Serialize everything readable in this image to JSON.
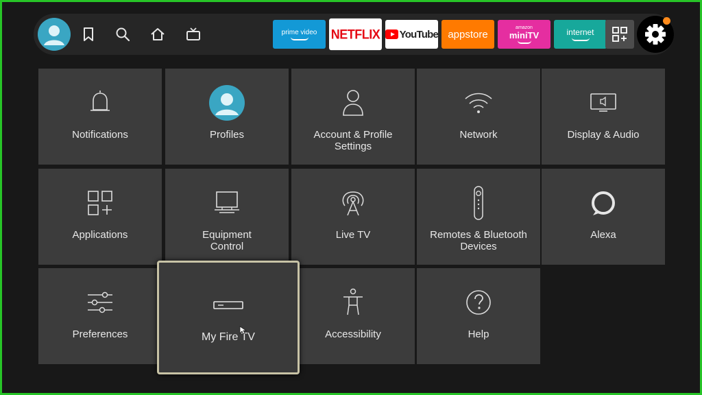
{
  "nav": {
    "icons": [
      "profile-avatar",
      "bookmark-icon",
      "search-icon",
      "home-icon",
      "live-tv-icon"
    ],
    "apps": [
      {
        "name": "prime video",
        "bg": "#1399d6"
      },
      {
        "name": "NETFLIX",
        "bg": "#ffffff"
      },
      {
        "name": "YouTube",
        "bg": "#ffffff"
      },
      {
        "name": "appstore",
        "bg": "#ff7a00"
      },
      {
        "top": "amazon",
        "name": "miniTV",
        "bg": "#e52ea0"
      },
      {
        "name": "internet",
        "bg": "#17a89b"
      }
    ],
    "app_grid_icon": "apps-grid-icon",
    "settings_icon": "gear-icon",
    "notification_dot_color": "#ff8a1a"
  },
  "tiles": [
    {
      "label": "Notifications",
      "icon": "bell-icon"
    },
    {
      "label": "Profiles",
      "icon": "profile-avatar-icon"
    },
    {
      "label": "Account & Profile\nSettings",
      "icon": "person-icon"
    },
    {
      "label": "Network",
      "icon": "wifi-icon"
    },
    {
      "label": "Display & Audio",
      "icon": "display-audio-icon"
    },
    {
      "label": "Applications",
      "icon": "apps-icon"
    },
    {
      "label": "Equipment\nControl",
      "icon": "monitor-icon"
    },
    {
      "label": "Live TV",
      "icon": "antenna-icon"
    },
    {
      "label": "Remotes & Bluetooth\nDevices",
      "icon": "remote-icon"
    },
    {
      "label": "Alexa",
      "icon": "alexa-icon"
    },
    {
      "label": "Preferences",
      "icon": "sliders-icon"
    },
    {
      "label": "My Fire TV",
      "icon": "fire-tv-device-icon",
      "focused": true
    },
    {
      "label": "Accessibility",
      "icon": "accessibility-icon"
    },
    {
      "label": "Help",
      "icon": "help-icon"
    }
  ],
  "colors": {
    "frame_border": "#27c427",
    "tile_bg": "#3c3c3c",
    "focus_border": "#c8c3a6"
  }
}
